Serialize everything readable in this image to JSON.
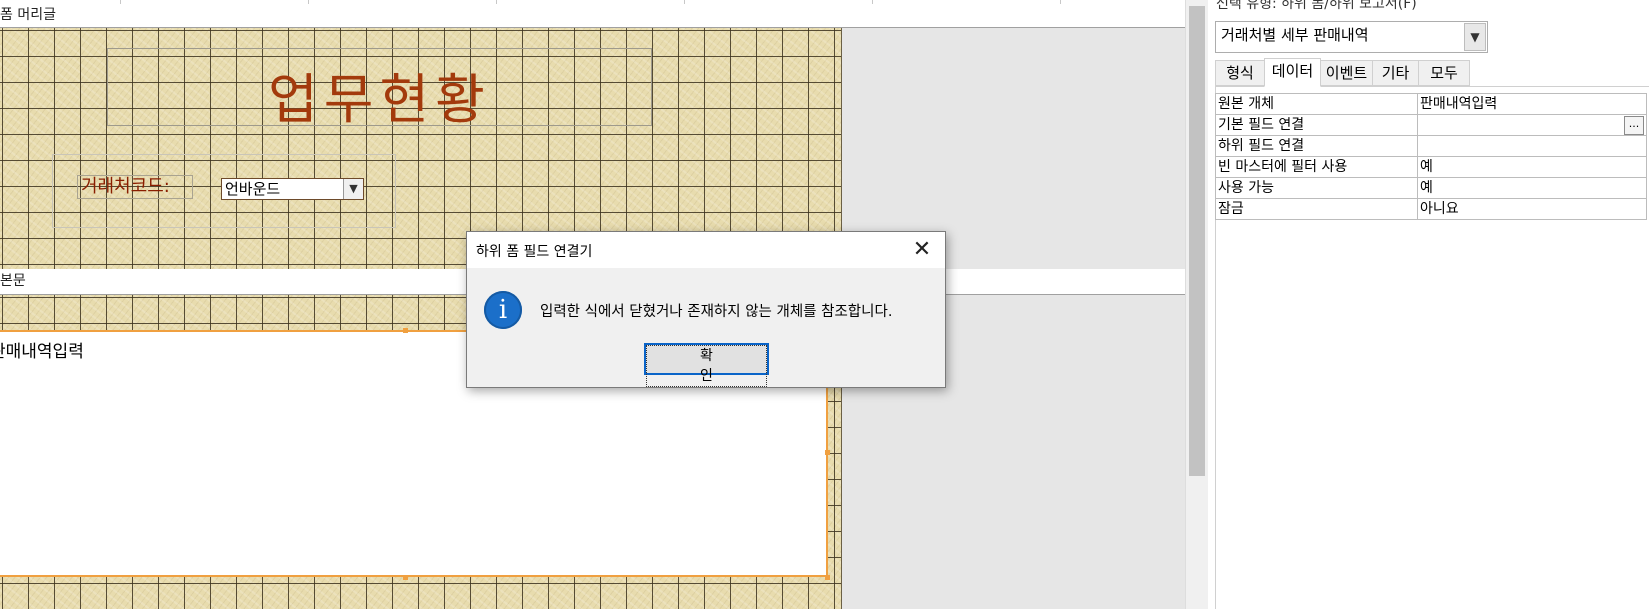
{
  "form": {
    "header_section_label": "폼 머리글",
    "detail_section_label": "본문",
    "title": "업무현황",
    "code_label": "거래처코드:",
    "code_value": "언바운드",
    "subform_label": "판매내역입력"
  },
  "property_sheet": {
    "selection_type": "선택 유형: 하위 폼/하위 보고서(F)",
    "object_name": "거래처별 세부 판매내역",
    "tabs": [
      {
        "label": "형식"
      },
      {
        "label": "데이터",
        "active": true
      },
      {
        "label": "이벤트"
      },
      {
        "label": "기타"
      },
      {
        "label": "모두"
      }
    ],
    "rows": [
      {
        "name": "원본 개체",
        "value": "판매내역입력"
      },
      {
        "name": "기본 필드 연결",
        "value": ""
      },
      {
        "name": "하위 필드 연결",
        "value": ""
      },
      {
        "name": "빈 마스터에 필터 사용",
        "value": "예"
      },
      {
        "name": "사용 가능",
        "value": "예"
      },
      {
        "name": "잠금",
        "value": "아니요"
      }
    ],
    "ellipsis_label": "..."
  },
  "dialog": {
    "title": "하위 폼 필드 연결기",
    "message": "입력한 식에서 닫혔거나 존재하지 않는 개체를 참조합니다.",
    "ok_label": "확인",
    "close_glyph": "✕",
    "info_glyph": "i"
  },
  "colors": {
    "title_text": "#a33a0c",
    "label_text": "#8a1e00",
    "selection_border": "#f0a040",
    "info_icon": "#1b6fc9",
    "ok_button_border": "#0a64c8"
  }
}
